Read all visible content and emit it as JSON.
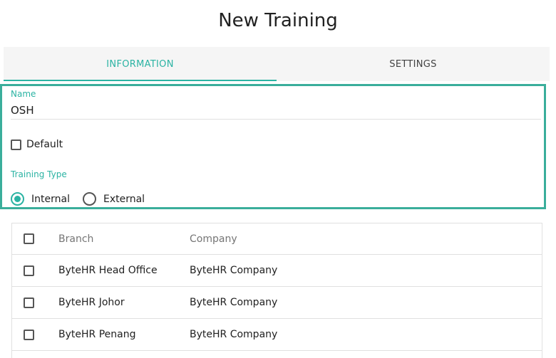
{
  "page": {
    "title": "New Training"
  },
  "tabs": [
    {
      "label": "INFORMATION",
      "active": true
    },
    {
      "label": "SETTINGS",
      "active": false
    }
  ],
  "form": {
    "name_label": "Name",
    "name_value": "OSH",
    "default_label": "Default",
    "default_checked": false,
    "training_type_label": "Training Type",
    "training_type_options": [
      {
        "label": "Internal",
        "selected": true
      },
      {
        "label": "External",
        "selected": false
      }
    ]
  },
  "table": {
    "columns": [
      "Branch",
      "Company"
    ],
    "rows": [
      {
        "branch": "ByteHR Head Office",
        "company": "ByteHR Company",
        "checked": false
      },
      {
        "branch": "ByteHR Johor",
        "company": "ByteHR Company",
        "checked": false
      },
      {
        "branch": "ByteHR Penang",
        "company": "ByteHR Company",
        "checked": false
      }
    ]
  },
  "colors": {
    "accent": "#2bb3a3",
    "form_border": "#3aae9b",
    "tab_bg": "#f5f5f5"
  }
}
